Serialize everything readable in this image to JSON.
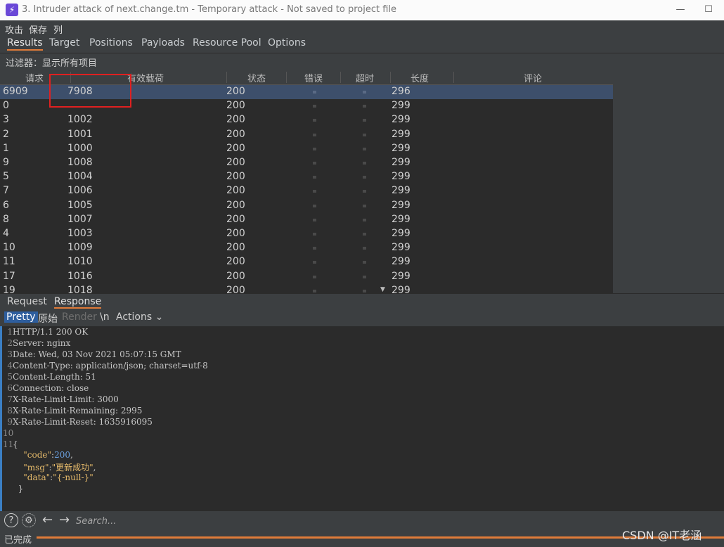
{
  "window": {
    "title": "3. Intruder attack of next.change.tm - Temporary attack - Not saved to project file",
    "app_icon": "⚡",
    "controls": [
      "—",
      "☐",
      "✕"
    ]
  },
  "menu": [
    "攻击",
    "保存",
    "列"
  ],
  "tabs": [
    {
      "label": "Results",
      "active": true
    },
    {
      "label": "Target"
    },
    {
      "label": "Positions"
    },
    {
      "label": "Payloads"
    },
    {
      "label": "Resource Pool"
    },
    {
      "label": "Options"
    }
  ],
  "filter": "过滤器：显示所有项目",
  "table": {
    "columns": [
      "请求",
      "有效载荷",
      "状态",
      "错误",
      "超时",
      "长度",
      "评论"
    ],
    "rows": [
      {
        "req": "6909",
        "payload": "7908",
        "status": "200",
        "len": "296",
        "selected": true
      },
      {
        "req": "0",
        "payload": "",
        "status": "200",
        "len": "299"
      },
      {
        "req": "3",
        "payload": "1002",
        "status": "200",
        "len": "299"
      },
      {
        "req": "2",
        "payload": "1001",
        "status": "200",
        "len": "299"
      },
      {
        "req": "1",
        "payload": "1000",
        "status": "200",
        "len": "299"
      },
      {
        "req": "9",
        "payload": "1008",
        "status": "200",
        "len": "299"
      },
      {
        "req": "5",
        "payload": "1004",
        "status": "200",
        "len": "299"
      },
      {
        "req": "7",
        "payload": "1006",
        "status": "200",
        "len": "299"
      },
      {
        "req": "6",
        "payload": "1005",
        "status": "200",
        "len": "299"
      },
      {
        "req": "8",
        "payload": "1007",
        "status": "200",
        "len": "299"
      },
      {
        "req": "4",
        "payload": "1003",
        "status": "200",
        "len": "299"
      },
      {
        "req": "10",
        "payload": "1009",
        "status": "200",
        "len": "299"
      },
      {
        "req": "11",
        "payload": "1010",
        "status": "200",
        "len": "299"
      },
      {
        "req": "17",
        "payload": "1016",
        "status": "200",
        "len": "299"
      },
      {
        "req": "19",
        "payload": "1018",
        "status": "200",
        "len": "299"
      }
    ]
  },
  "subtabs": [
    {
      "label": "Request"
    },
    {
      "label": "Response",
      "active": true
    }
  ],
  "viewbar": {
    "pretty": "Pretty",
    "raw": "原始",
    "render": "Render",
    "newline": "\\n",
    "actions": "Actions ⌄"
  },
  "response_lines": [
    {
      "n": "1",
      "text": "HTTP/1.1 200 OK"
    },
    {
      "n": "2",
      "text": "Server: nginx"
    },
    {
      "n": "3",
      "text": "Date: Wed, 03 Nov 2021 05:07:15 GMT"
    },
    {
      "n": "4",
      "text": "Content-Type: application/json; charset=utf-8"
    },
    {
      "n": "5",
      "text": "Content-Length: 51"
    },
    {
      "n": "6",
      "text": "Connection: close"
    },
    {
      "n": "7",
      "text": "X-Rate-Limit-Limit: 3000"
    },
    {
      "n": "8",
      "text": "X-Rate-Limit-Remaining: 2995"
    },
    {
      "n": "9",
      "text": "X-Rate-Limit-Reset: 1635916095"
    },
    {
      "n": "10",
      "text": ""
    },
    {
      "n": "11",
      "text": "{"
    }
  ],
  "json_body": {
    "code_key": "\"code\"",
    "code_val": "200",
    "msg_key": "\"msg\"",
    "msg_val": "\"更新成功\"",
    "data_key": "\"data\"",
    "data_val": "\"{-null-}\"",
    "close": "}"
  },
  "search": {
    "placeholder": "Search..."
  },
  "status": "已完成",
  "watermark": "CSDN @IT老涵",
  "colors": {
    "accent": "#e07b39",
    "selection": "#3d4f6b",
    "highlight_box": "#e02020"
  }
}
